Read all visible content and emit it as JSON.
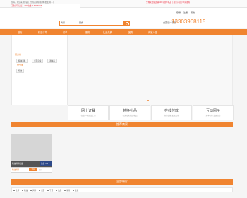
{
  "topbar": {
    "notice": "您好，欢迎来到鲜品汇 全国首家粮油调料批发网(...)",
    "promo": "全城免费配送满500享豪华礼品 | 商家入驻 | 申请团购",
    "promo2": "卫生部门认证 | 400热线: 13303968115"
  },
  "header": {
    "links": [
      "登录",
      "注册",
      "帮助"
    ],
    "search_select": "商家",
    "search_value": "服务",
    "phone_label": "全国统一热线",
    "phone": "13303968115"
  },
  "nav": {
    "items": [
      "首页",
      "精选订单",
      "订单",
      "服务",
      "礼品兑换",
      "团购",
      "商家入驻"
    ]
  },
  "category_panel": {
    "section1_title": "服务商",
    "section1_items": [
      "粮油调料",
      "米面杂粮",
      "调味品"
    ],
    "section2_title": "工作分类",
    "section2_items": [
      "粮油"
    ]
  },
  "services": [
    {
      "title": "网上订餐",
      "desc": "在线下单 送货上门"
    },
    {
      "title": "兑换礼品",
      "desc": "积分兑换 精美礼品"
    },
    {
      "title": "在线付款",
      "desc": "方便快捷 安全支付"
    },
    {
      "title": "互动圈子",
      "desc": "分享心得 交流经验"
    }
  ],
  "sections": {
    "recommended": "推荐商家",
    "all": "全部餐厅"
  },
  "shop": {
    "name": "粮油调料批发",
    "rating_label": "信誉",
    "rating": "5.0",
    "type": "粮油调料",
    "tag": "营业",
    "location": "郑州"
  },
  "filters": [
    "全部",
    "粮油",
    "调料",
    "米面",
    "干货",
    "饮品",
    "冷冻",
    "其他"
  ],
  "colors": {
    "accent": "#f08430",
    "nav_text": "#ffffff"
  }
}
